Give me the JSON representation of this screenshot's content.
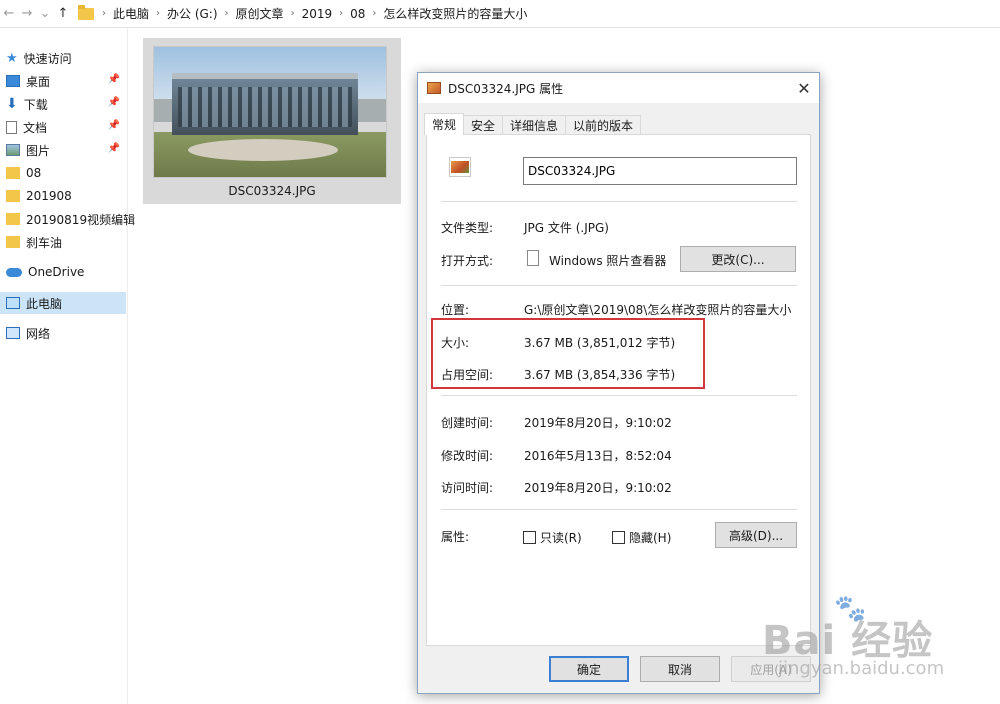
{
  "address_bar": {
    "back": "←",
    "forward": "→",
    "recent": "⌄",
    "up": "↑",
    "crumbs": [
      "此电脑",
      "办公 (G:)",
      "原创文章",
      "2019",
      "08",
      "怎么样改变照片的容量大小"
    ],
    "separator": "›"
  },
  "sidebar": {
    "quick_access": "快速访问",
    "items": [
      {
        "label": "桌面",
        "pinned": true
      },
      {
        "label": "下载",
        "pinned": true
      },
      {
        "label": "文档",
        "pinned": true
      },
      {
        "label": "图片",
        "pinned": true
      },
      {
        "label": "08"
      },
      {
        "label": "201908"
      },
      {
        "label": "20190819视频编辑"
      },
      {
        "label": "刹车油"
      }
    ],
    "onedrive": "OneDrive",
    "this_pc": "此电脑",
    "network": "网络",
    "pin_glyph": "📌"
  },
  "file_tile": {
    "name": "DSC03324.JPG"
  },
  "dialog": {
    "title": "DSC03324.JPG 属性",
    "close": "✕",
    "tabs": [
      "常规",
      "安全",
      "详细信息",
      "以前的版本"
    ],
    "active_tab": "常规",
    "filename": "DSC03324.JPG",
    "type_label": "文件类型:",
    "type_value": "JPG 文件 (.JPG)",
    "opens_label": "打开方式:",
    "opens_value": "Windows 照片查看器",
    "change_button": "更改(C)...",
    "location_label": "位置:",
    "location_value": "G:\\原创文章\\2019\\08\\怎么样改变照片的容量大小",
    "size_label": "大小:",
    "size_value": "3.67 MB (3,851,012 字节)",
    "disk_label": "占用空间:",
    "disk_value": "3.67 MB (3,854,336 字节)",
    "created_label": "创建时间:",
    "created_value": "2019年8月20日，9:10:02",
    "modified_label": "修改时间:",
    "modified_value": "2016年5月13日，8:52:04",
    "accessed_label": "访问时间:",
    "accessed_value": "2019年8月20日，9:10:02",
    "attributes_label": "属性:",
    "readonly_label": "只读(R)",
    "hidden_label": "隐藏(H)",
    "readonly_checked": false,
    "hidden_checked": false,
    "advanced_button": "高级(D)...",
    "ok_button": "确定",
    "cancel_button": "取消",
    "apply_button": "应用(A)",
    "highlight_color": "#d1373a"
  },
  "watermark": {
    "brand": "Bai 经验",
    "paw": "🐾",
    "url": "jingyan.baidu.com"
  }
}
